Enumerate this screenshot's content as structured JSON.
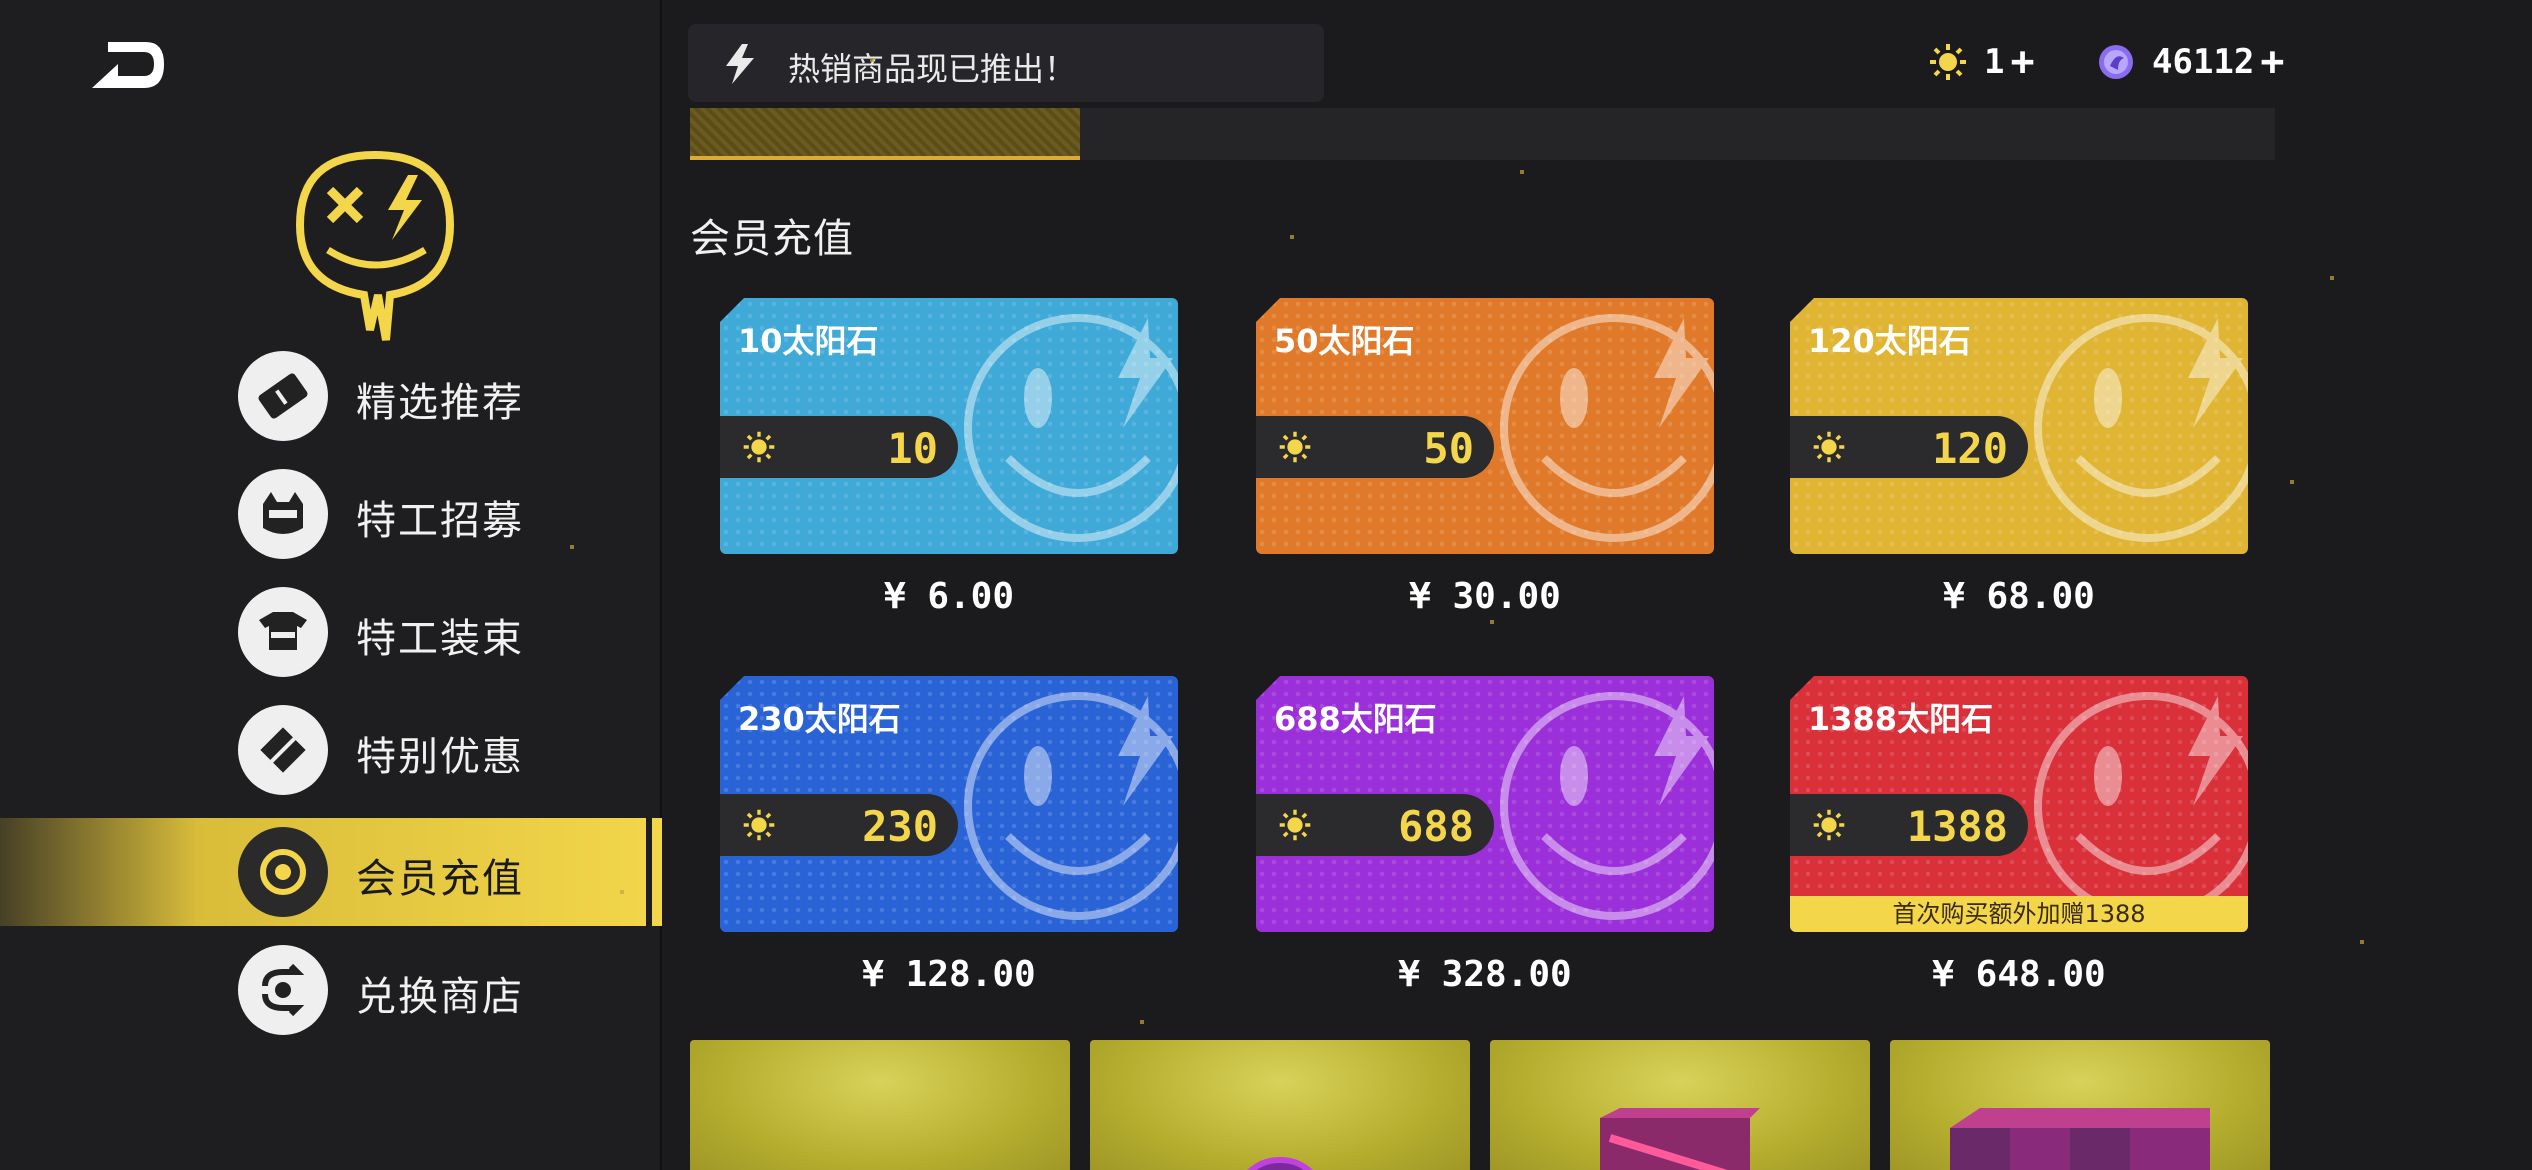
{
  "promo": {
    "text": "热销商品现已推出！"
  },
  "currencies": [
    {
      "icon": "sunstone-icon",
      "value": "1"
    },
    {
      "icon": "gem-icon",
      "value": "46112"
    }
  ],
  "sidebar": {
    "items": [
      {
        "label": "精选推荐",
        "icon": "ticket-icon",
        "active": false
      },
      {
        "label": "特工招募",
        "icon": "cat-agent-icon",
        "active": false
      },
      {
        "label": "特工装束",
        "icon": "outfit-icon",
        "active": false
      },
      {
        "label": "特别优惠",
        "icon": "discount-icon",
        "active": false
      },
      {
        "label": "会员充值",
        "icon": "coin-target-icon",
        "active": true
      },
      {
        "label": "兑换商店",
        "icon": "exchange-icon",
        "active": false
      }
    ]
  },
  "main": {
    "section_title": "会员充值",
    "packs": [
      {
        "title": "10太阳石",
        "amount": "10",
        "price": "¥ 6.00",
        "color": "#3fa9d8"
      },
      {
        "title": "50太阳石",
        "amount": "50",
        "price": "¥ 30.00",
        "color": "#e07a2a"
      },
      {
        "title": "120太阳石",
        "amount": "120",
        "price": "¥ 68.00",
        "color": "#e0b534"
      },
      {
        "title": "230太阳石",
        "amount": "230",
        "price": "¥ 128.00",
        "color": "#2a63d6"
      },
      {
        "title": "688太阳石",
        "amount": "688",
        "price": "¥ 328.00",
        "color": "#9b2fd9"
      },
      {
        "title": "1388太阳石",
        "amount": "1388",
        "price": "¥ 648.00",
        "color": "#d9303a",
        "bonus": "首次购买额外加赠1388"
      }
    ]
  },
  "colors": {
    "accent": "#f3d64a",
    "background": "#1b1b1d"
  }
}
